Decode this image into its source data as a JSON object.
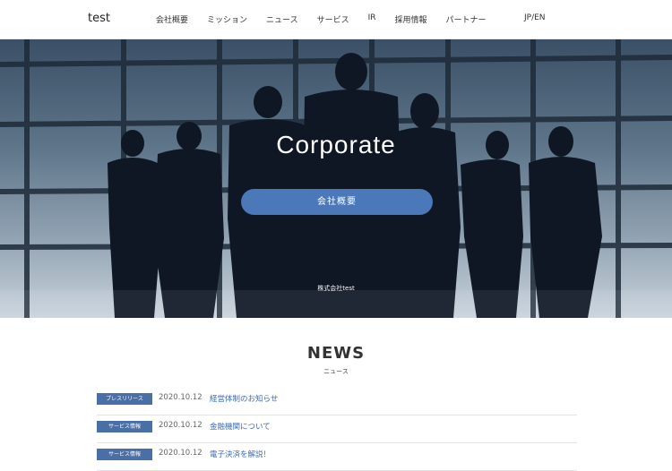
{
  "header": {
    "logo": "test",
    "nav": [
      "会社概要",
      "ミッション",
      "ニュース",
      "サービス",
      "IR",
      "採用情報",
      "パートナー"
    ],
    "lang": "JP/EN"
  },
  "hero": {
    "title": "Corporate",
    "button_label": "会社概要",
    "caption": "株式会社test"
  },
  "news": {
    "title": "NEWS",
    "subtitle": "ニュース",
    "items": [
      {
        "category": "プレスリリース",
        "date": "2020.10.12",
        "title": "経営体制のお知らせ"
      },
      {
        "category": "サービス情報",
        "date": "2020.10.12",
        "title": "金融機関について"
      },
      {
        "category": "サービス情報",
        "date": "2020.10.12",
        "title": "電子決済を解説！"
      }
    ]
  },
  "colors": {
    "accent": "#4a78b8",
    "badge": "#4a6ea6",
    "link": "#3d6db3"
  }
}
